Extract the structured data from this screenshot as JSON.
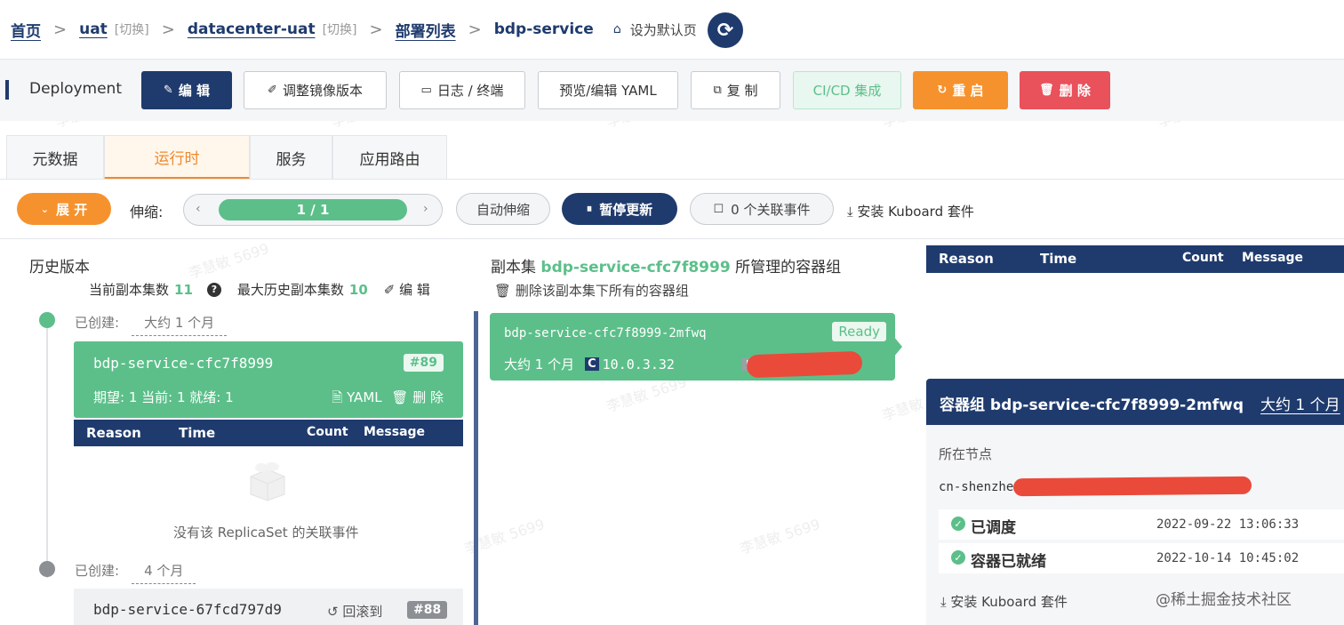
{
  "breadcrumb": {
    "home": "首页",
    "namespace": "uat",
    "switch1": "[切换]",
    "cluster": "datacenter-uat",
    "switch2": "[切换]",
    "list": "部署列表",
    "current": "bdp-service",
    "set_default": "设为默认页",
    "separator": ">"
  },
  "toolbar": {
    "kind": "Deployment",
    "edit": "编 辑",
    "adjust_image": "调整镜像版本",
    "logs": "日志 / 终端",
    "yaml": "预览/编辑 YAML",
    "copy": "复 制",
    "cicd": "CI/CD 集成",
    "restart": "重 启",
    "delete": "删 除"
  },
  "tabs": [
    "元数据",
    "运行时",
    "服务",
    "应用路由"
  ],
  "active_tab": "运行时",
  "scale": {
    "expand": "展 开",
    "label": "伸缩:",
    "value": "1 / 1",
    "auto": "自动伸缩",
    "pause": "暂停更新",
    "events": "0 个关联事件",
    "install": "安装 Kuboard 套件"
  },
  "history": {
    "title": "历史版本",
    "current_label": "当前副本集数",
    "current_count": "11",
    "max_label": "最大历史副本集数",
    "max_count": "10",
    "edit": "编 辑",
    "created_label": "已创建:",
    "items": [
      {
        "created": "大约 1 个月",
        "name": "bdp-service-cfc7f8999",
        "tag": "#89",
        "status": "期望: 1 当前: 1 就绪: 1",
        "yaml": "YAML",
        "delete": "删 除"
      },
      {
        "created": "4 个月",
        "name": "bdp-service-67fcd797d9",
        "rollback": "回滚到",
        "tag": "#88"
      }
    ],
    "events_header": [
      "Reason",
      "Time",
      "Count",
      "Message"
    ],
    "empty_text": "没有该 ReplicaSet 的关联事件"
  },
  "replicaset": {
    "title_prefix": "副本集",
    "title_name": "bdp-service-cfc7f8999",
    "title_suffix": "所管理的容器组",
    "delete_all": "删除该副本集下所有的容器组",
    "pod": {
      "name": "bdp-service-cfc7f8999-2mfwq",
      "status": "Ready",
      "age": "大约 1 个月",
      "c_badge": "C",
      "ip": "10.0.3.32",
      "h_badge": "H"
    }
  },
  "right": {
    "events_header": [
      "Reason",
      "Time",
      "Count",
      "Message"
    ],
    "pod_panel": {
      "label": "容器组",
      "name": "bdp-service-cfc7f8999-2mfwq",
      "age": "大约 1 个月",
      "node_label": "所在节点",
      "node_value": "cn-shenzhe",
      "conditions": [
        {
          "name": "已调度",
          "time": "2022-09-22 13:06:33"
        },
        {
          "name": "容器已就绪",
          "time": "2022-10-14 10:45:02"
        }
      ],
      "install": "安装 Kuboard 套件"
    }
  },
  "watermark": "李慧敏 5699",
  "site_watermark": "@稀土掘金技术社区",
  "colors": {
    "navy": "#1f3b6e",
    "green": "#5cbf8a",
    "orange": "#f6922d",
    "red": "#e9515b"
  }
}
